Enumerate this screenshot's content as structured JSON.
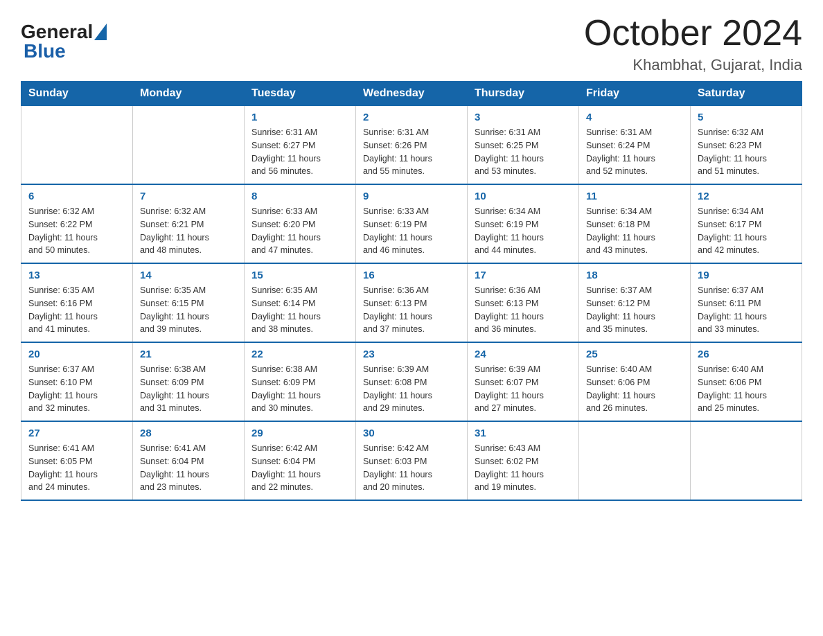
{
  "header": {
    "logo_general": "General",
    "logo_blue": "Blue",
    "month": "October 2024",
    "location": "Khambhat, Gujarat, India"
  },
  "days_of_week": [
    "Sunday",
    "Monday",
    "Tuesday",
    "Wednesday",
    "Thursday",
    "Friday",
    "Saturday"
  ],
  "weeks": [
    [
      {
        "day": "",
        "info": ""
      },
      {
        "day": "",
        "info": ""
      },
      {
        "day": "1",
        "info": "Sunrise: 6:31 AM\nSunset: 6:27 PM\nDaylight: 11 hours\nand 56 minutes."
      },
      {
        "day": "2",
        "info": "Sunrise: 6:31 AM\nSunset: 6:26 PM\nDaylight: 11 hours\nand 55 minutes."
      },
      {
        "day": "3",
        "info": "Sunrise: 6:31 AM\nSunset: 6:25 PM\nDaylight: 11 hours\nand 53 minutes."
      },
      {
        "day": "4",
        "info": "Sunrise: 6:31 AM\nSunset: 6:24 PM\nDaylight: 11 hours\nand 52 minutes."
      },
      {
        "day": "5",
        "info": "Sunrise: 6:32 AM\nSunset: 6:23 PM\nDaylight: 11 hours\nand 51 minutes."
      }
    ],
    [
      {
        "day": "6",
        "info": "Sunrise: 6:32 AM\nSunset: 6:22 PM\nDaylight: 11 hours\nand 50 minutes."
      },
      {
        "day": "7",
        "info": "Sunrise: 6:32 AM\nSunset: 6:21 PM\nDaylight: 11 hours\nand 48 minutes."
      },
      {
        "day": "8",
        "info": "Sunrise: 6:33 AM\nSunset: 6:20 PM\nDaylight: 11 hours\nand 47 minutes."
      },
      {
        "day": "9",
        "info": "Sunrise: 6:33 AM\nSunset: 6:19 PM\nDaylight: 11 hours\nand 46 minutes."
      },
      {
        "day": "10",
        "info": "Sunrise: 6:34 AM\nSunset: 6:19 PM\nDaylight: 11 hours\nand 44 minutes."
      },
      {
        "day": "11",
        "info": "Sunrise: 6:34 AM\nSunset: 6:18 PM\nDaylight: 11 hours\nand 43 minutes."
      },
      {
        "day": "12",
        "info": "Sunrise: 6:34 AM\nSunset: 6:17 PM\nDaylight: 11 hours\nand 42 minutes."
      }
    ],
    [
      {
        "day": "13",
        "info": "Sunrise: 6:35 AM\nSunset: 6:16 PM\nDaylight: 11 hours\nand 41 minutes."
      },
      {
        "day": "14",
        "info": "Sunrise: 6:35 AM\nSunset: 6:15 PM\nDaylight: 11 hours\nand 39 minutes."
      },
      {
        "day": "15",
        "info": "Sunrise: 6:35 AM\nSunset: 6:14 PM\nDaylight: 11 hours\nand 38 minutes."
      },
      {
        "day": "16",
        "info": "Sunrise: 6:36 AM\nSunset: 6:13 PM\nDaylight: 11 hours\nand 37 minutes."
      },
      {
        "day": "17",
        "info": "Sunrise: 6:36 AM\nSunset: 6:13 PM\nDaylight: 11 hours\nand 36 minutes."
      },
      {
        "day": "18",
        "info": "Sunrise: 6:37 AM\nSunset: 6:12 PM\nDaylight: 11 hours\nand 35 minutes."
      },
      {
        "day": "19",
        "info": "Sunrise: 6:37 AM\nSunset: 6:11 PM\nDaylight: 11 hours\nand 33 minutes."
      }
    ],
    [
      {
        "day": "20",
        "info": "Sunrise: 6:37 AM\nSunset: 6:10 PM\nDaylight: 11 hours\nand 32 minutes."
      },
      {
        "day": "21",
        "info": "Sunrise: 6:38 AM\nSunset: 6:09 PM\nDaylight: 11 hours\nand 31 minutes."
      },
      {
        "day": "22",
        "info": "Sunrise: 6:38 AM\nSunset: 6:09 PM\nDaylight: 11 hours\nand 30 minutes."
      },
      {
        "day": "23",
        "info": "Sunrise: 6:39 AM\nSunset: 6:08 PM\nDaylight: 11 hours\nand 29 minutes."
      },
      {
        "day": "24",
        "info": "Sunrise: 6:39 AM\nSunset: 6:07 PM\nDaylight: 11 hours\nand 27 minutes."
      },
      {
        "day": "25",
        "info": "Sunrise: 6:40 AM\nSunset: 6:06 PM\nDaylight: 11 hours\nand 26 minutes."
      },
      {
        "day": "26",
        "info": "Sunrise: 6:40 AM\nSunset: 6:06 PM\nDaylight: 11 hours\nand 25 minutes."
      }
    ],
    [
      {
        "day": "27",
        "info": "Sunrise: 6:41 AM\nSunset: 6:05 PM\nDaylight: 11 hours\nand 24 minutes."
      },
      {
        "day": "28",
        "info": "Sunrise: 6:41 AM\nSunset: 6:04 PM\nDaylight: 11 hours\nand 23 minutes."
      },
      {
        "day": "29",
        "info": "Sunrise: 6:42 AM\nSunset: 6:04 PM\nDaylight: 11 hours\nand 22 minutes."
      },
      {
        "day": "30",
        "info": "Sunrise: 6:42 AM\nSunset: 6:03 PM\nDaylight: 11 hours\nand 20 minutes."
      },
      {
        "day": "31",
        "info": "Sunrise: 6:43 AM\nSunset: 6:02 PM\nDaylight: 11 hours\nand 19 minutes."
      },
      {
        "day": "",
        "info": ""
      },
      {
        "day": "",
        "info": ""
      }
    ]
  ]
}
